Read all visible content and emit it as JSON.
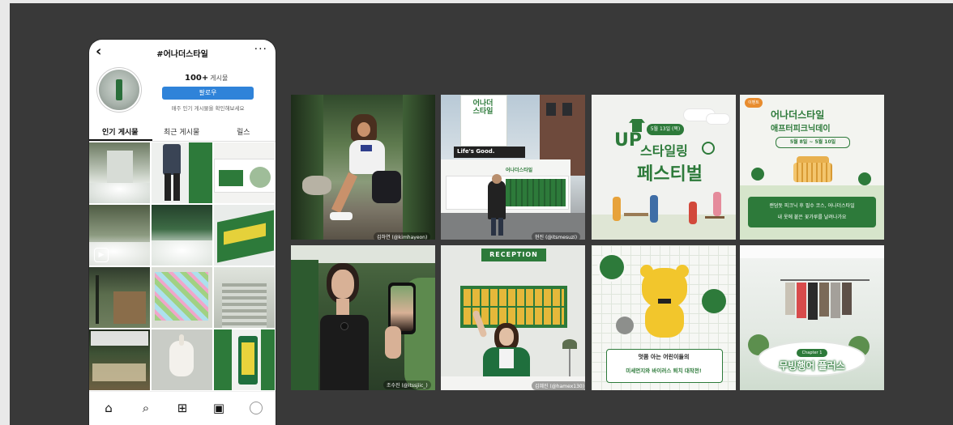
{
  "phone": {
    "title": "#어나더스타일",
    "back_icon": "chevron-left-icon",
    "more_icon": "more-horizontal-icon",
    "posts_count": "100+",
    "posts_label": "게시물",
    "follow_label": "팔로우",
    "note": "매주 인기 게시물을 확인해보세요",
    "tabs": [
      {
        "label": "인기 게시물",
        "active": true
      },
      {
        "label": "최근 게시물",
        "active": false
      },
      {
        "label": "릴스",
        "active": false
      }
    ],
    "nav_icons": [
      "home-icon",
      "search-icon",
      "add-post-icon",
      "reels-icon",
      "profile-icon"
    ]
  },
  "posts": [
    {
      "tag": "김하연 (@kimhayeon)"
    },
    {
      "tag": "현진 (@itsmesuzi)",
      "sign": "어나더스타일",
      "sign2": "어나더\n스타일",
      "store": "Life's Good."
    },
    {
      "up": "UP",
      "date": "5월 13일 (목)",
      "line1": "스타일링",
      "line2": "페스티벌"
    },
    {
      "badge": "이벤트",
      "title": "어나더스타일",
      "subtitle": "애프터피크닉데이",
      "dates": "5월 8일 ~ 5월 10일",
      "caption1": "랜덤돗 피크닉 후 필수 코스, 어나더스타일",
      "caption2": "내 옷에 붙은 꽃가루를 날려나가요"
    },
    {
      "tag": "조수진 (@itssjiic_)"
    },
    {
      "reception": "RECEPTION",
      "tag": "김혜진 (@hamex130)"
    },
    {
      "caption1": "멋쫌 아는 어린이들의",
      "caption2": "미세먼지와 바이러스 퇴치 대작전!"
    },
    {
      "chapter": "Chapter 1",
      "title": "무빙행어 플러스"
    }
  ],
  "colors": {
    "brand_green": "#2d7a3a",
    "dark_bg": "#393939",
    "follow_blue": "#2f83d9"
  }
}
